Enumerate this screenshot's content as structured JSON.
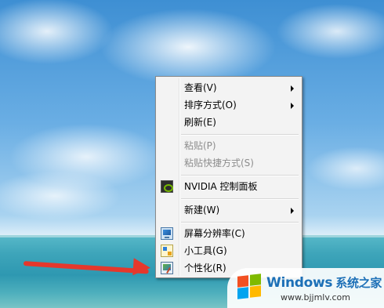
{
  "context_menu": {
    "items": [
      {
        "label": "查看(V)",
        "submenu": true
      },
      {
        "label": "排序方式(O)",
        "submenu": true
      },
      {
        "label": "刷新(E)"
      },
      {
        "label": "粘贴(P)",
        "disabled": true
      },
      {
        "label": "粘贴快捷方式(S)",
        "disabled": true
      },
      {
        "label": "NVIDIA 控制面板",
        "icon": "nvidia-icon"
      },
      {
        "label": "新建(W)",
        "submenu": true
      },
      {
        "label": "屏幕分辨率(C)",
        "icon": "monitor-resolution-icon"
      },
      {
        "label": "小工具(G)",
        "icon": "gadgets-icon"
      },
      {
        "label": "个性化(R)",
        "icon": "personalize-icon"
      }
    ]
  },
  "annotation": {
    "arrow_color": "#e5382c",
    "points_to": "个性化(R)"
  },
  "watermark": {
    "title": "Windows",
    "title_cn": "系统之家",
    "url": "www.bjjmlv.com",
    "brand_color": "#1d70b7"
  }
}
